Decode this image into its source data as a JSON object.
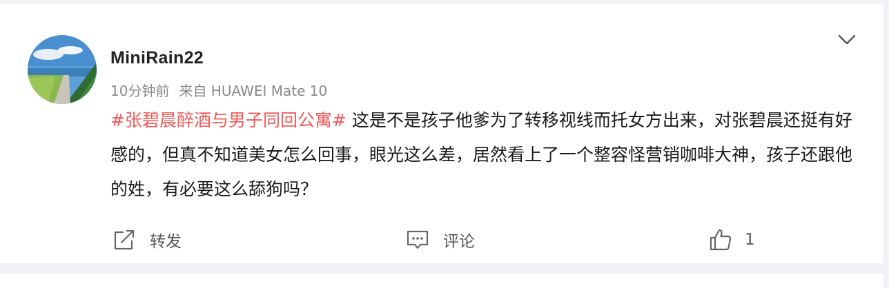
{
  "post": {
    "username": "MiniRain22",
    "time": "10分钟前",
    "source": "来自 HUAWEI Mate 10",
    "hashtag": "#张碧晨醉酒与男子同回公寓#",
    "text": " 这是不是孩子他爹为了转移视线而托女方出来，对张碧晨还挺有好感的，但真不知道美女怎么回事，眼光这么差，居然看上了一个整容怪营销咖啡大神，孩子还跟他的姓，有必要这么舔狗吗？"
  },
  "actions": {
    "repost_label": "转发",
    "comment_label": "评论",
    "like_count": "1"
  },
  "icons": {
    "menu": "chevron-down-icon",
    "repost": "share-icon",
    "comment": "comment-icon",
    "like": "thumbs-up-icon"
  },
  "colors": {
    "hashtag": "#f05a5a",
    "username": "#222222",
    "meta": "#8a8a8a",
    "background": "#f1f2f5"
  }
}
